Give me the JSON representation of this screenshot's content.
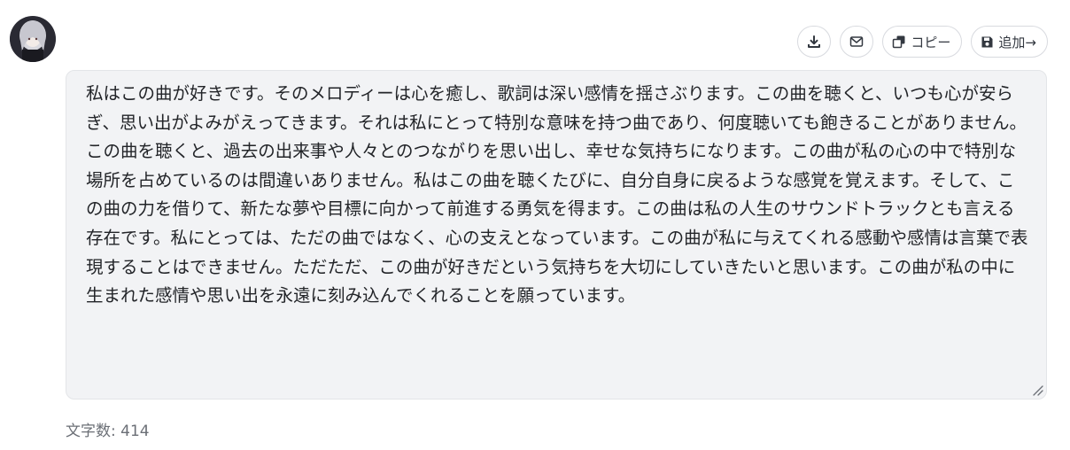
{
  "toolbar": {
    "download_icon": "download-icon",
    "mail_icon": "mail-icon",
    "copy_label": "コピー",
    "copy_icon": "copy-icon",
    "add_label": "追加→",
    "save_icon": "save-icon"
  },
  "editor": {
    "text": "私はこの曲が好きです。そのメロディーは心を癒し、歌詞は深い感情を揺さぶります。この曲を聴くと、いつも心が安らぎ、思い出がよみがえってきます。それは私にとって特別な意味を持つ曲であり、何度聴いても飽きることがありません。この曲を聴くと、過去の出来事や人々とのつながりを思い出し、幸せな気持ちになります。この曲が私の心の中で特別な場所を占めているのは間違いありません。私はこの曲を聴くたびに、自分自身に戻るような感覚を覚えます。そして、この曲の力を借りて、新たな夢や目標に向かって前進する勇気を得ます。この曲は私の人生のサウンドトラックとも言える存在です。私にとっては、ただの曲ではなく、心の支えとなっています。この曲が私に与えてくれる感動や感情は言葉で表現することはできません。ただただ、この曲が好きだという気持ちを大切にしていきたいと思います。この曲が私の中に生まれた感情や思い出を永遠に刻み込んでくれることを願っています。"
  },
  "footer": {
    "char_count": "文字数: 414"
  }
}
